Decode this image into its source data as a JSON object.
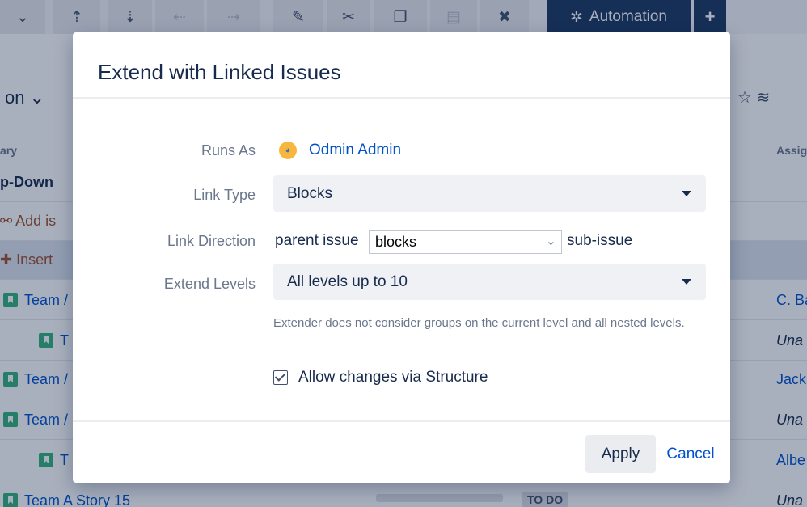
{
  "toolbar": {
    "icons": [
      "chevron-down-icon",
      "move-up-icon",
      "move-down-icon",
      "outdent-icon",
      "indent-icon",
      "edit-icon",
      "cut-icon",
      "copy-icon",
      "paste-icon",
      "delete-icon",
      "automation-icon",
      "plus-icon"
    ],
    "automation_label": "Automation"
  },
  "background": {
    "structure_name_fragment": "on",
    "col_summary_fragment": "ary",
    "col_assignee_fragment": "Assig",
    "rows": [
      {
        "label": "p-Down",
        "right": ""
      },
      {
        "label": "Add is",
        "right": ""
      },
      {
        "label": "Insert",
        "right": ""
      },
      {
        "label": "Team /",
        "right": "C. Ba"
      },
      {
        "label": "T",
        "right": "Una"
      },
      {
        "label": "Team /",
        "right": "Jack"
      },
      {
        "label": "Team /",
        "right": "Una"
      },
      {
        "label": "T",
        "right": "Albe"
      },
      {
        "label": "Team A Story 15",
        "right": "Una"
      }
    ],
    "status_badge": "TO DO"
  },
  "dialog": {
    "title": "Extend with Linked Issues",
    "runs_as": {
      "label": "Runs As",
      "user": "Odmin Admin"
    },
    "link_type": {
      "label": "Link Type",
      "value": "Blocks"
    },
    "link_direction": {
      "label": "Link Direction",
      "prefix": "parent issue",
      "value": "blocks",
      "suffix": "sub-issue"
    },
    "extend_levels": {
      "label": "Extend Levels",
      "value": "All levels up to 10"
    },
    "hint": "Extender does not consider groups on the current level and all nested levels.",
    "allow_changes": {
      "label": "Allow changes via Structure",
      "checked": true
    },
    "apply_label": "Apply",
    "cancel_label": "Cancel"
  },
  "colors": {
    "accent": "#0052cc",
    "automation_bg": "#1e3a63",
    "story_icon": "#36b37e"
  }
}
